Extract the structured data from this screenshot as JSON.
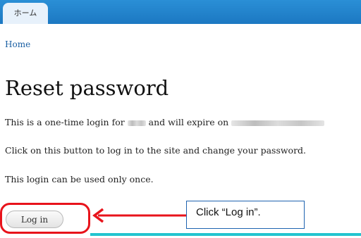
{
  "header": {
    "tab_label": "ホーム"
  },
  "breadcrumb": {
    "home_label": "Home"
  },
  "page": {
    "title": "Reset password",
    "line1_prefix": "This is a one-time login for",
    "line1_middle": "and will expire on",
    "line2": "Click on this button to log in to the site and change your password.",
    "line3": "This login can be used only once."
  },
  "actions": {
    "login_label": "Log in"
  },
  "annotation": {
    "callout_text": "Click “Log in”.",
    "highlight_color": "#e8131b",
    "callout_border_color": "#1e63b0"
  },
  "colors": {
    "topbar": "#1c78c2",
    "link": "#1a5fa3",
    "accent_line": "#23c4cf"
  }
}
